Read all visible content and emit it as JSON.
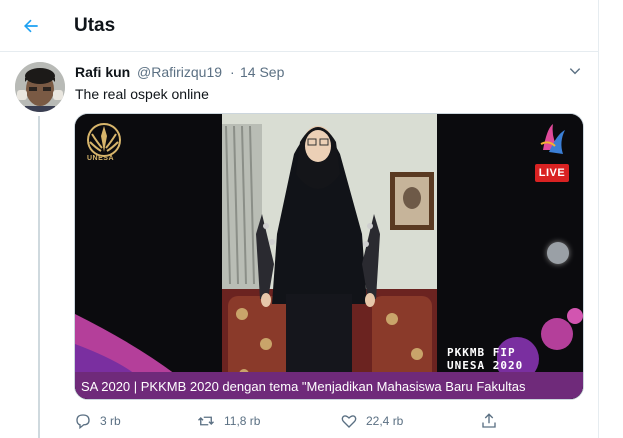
{
  "header": {
    "title": "Utas",
    "back_icon": "arrow-left-icon",
    "accent_color": "#1da1f2"
  },
  "tweet": {
    "name": "Rafi kun",
    "handle": "@Rafirizqu19",
    "separator": "·",
    "date": "14 Sep",
    "text": "The real ospek online",
    "more_icon": "chevron-down-icon"
  },
  "media": {
    "logo_text": "UNESA",
    "live_label": "LIVE",
    "pkkmb_text": "PKKMB FIP\nUNESA 2020",
    "ticker_text": "SA 2020  |  PKKMB 2020 dengan tema \"Menjadikan Mahasiswa Baru Fakultas"
  },
  "actions": {
    "reply_count": "3 rb",
    "retweet_count": "11,8 rb",
    "like_count": "22,4 rb",
    "reply_icon": "reply-icon",
    "retweet_icon": "retweet-icon",
    "like_icon": "heart-icon",
    "share_icon": "share-icon"
  }
}
